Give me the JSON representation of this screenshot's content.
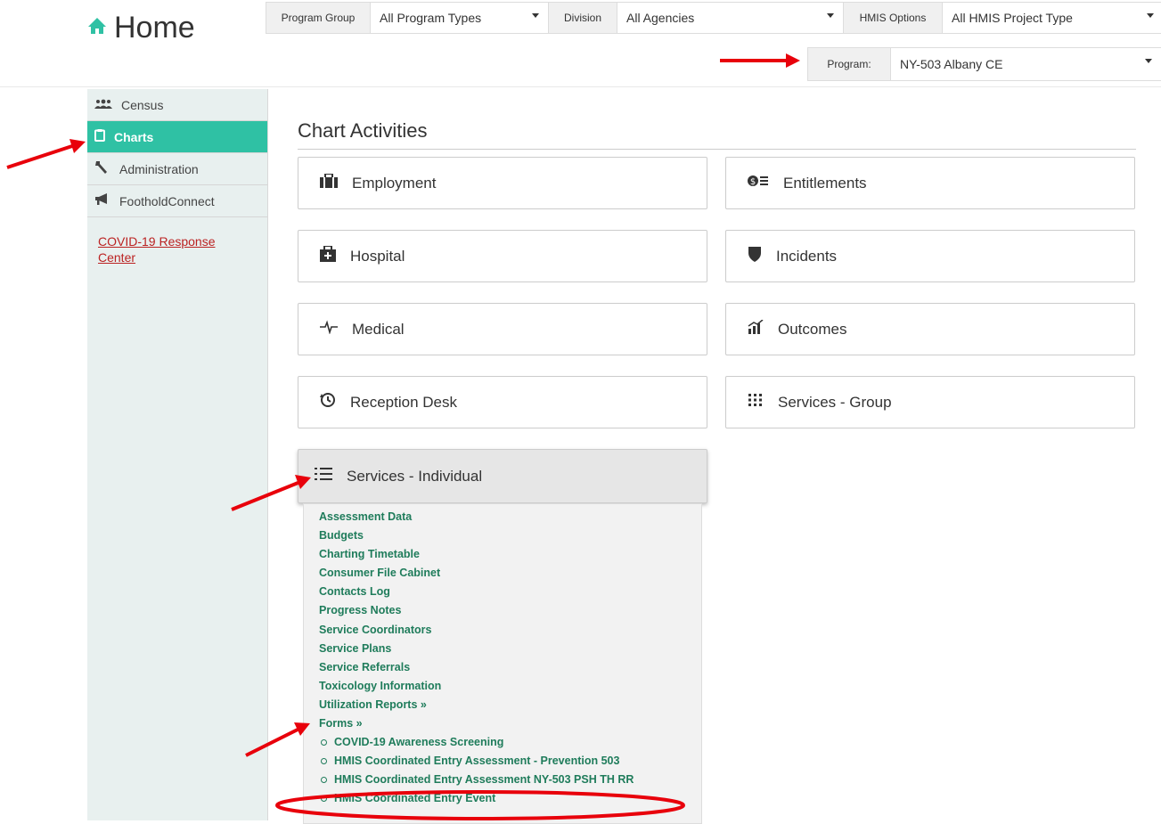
{
  "header": {
    "title": "Home",
    "filters": [
      {
        "label": "Program Group",
        "value": "All Program Types"
      },
      {
        "label": "Division",
        "value": "All Agencies"
      },
      {
        "label": "HMIS Options",
        "value": "All HMIS Project Type"
      }
    ],
    "program": {
      "label": "Program:",
      "value": "NY-503 Albany CE"
    }
  },
  "sidebar": {
    "items": [
      {
        "label": "Census",
        "icon": "users-icon"
      },
      {
        "label": "Charts",
        "icon": "clipboard-icon",
        "active": true
      },
      {
        "label": "Administration",
        "icon": "wrench-icon"
      },
      {
        "label": "FootholdConnect",
        "icon": "megaphone-icon"
      }
    ],
    "covid_link": "COVID-19 Response Center"
  },
  "main": {
    "section_title": "Chart Activities",
    "tiles": [
      {
        "label": "Employment",
        "icon": "briefcase-icon"
      },
      {
        "label": "Entitlements",
        "icon": "money-list-icon"
      },
      {
        "label": "Hospital",
        "icon": "medkit-icon"
      },
      {
        "label": "Incidents",
        "icon": "shield-icon"
      },
      {
        "label": "Medical",
        "icon": "heartbeat-icon"
      },
      {
        "label": "Outcomes",
        "icon": "bar-chart-icon"
      },
      {
        "label": "Reception Desk",
        "icon": "history-icon"
      },
      {
        "label": "Services - Group",
        "icon": "grid-icon"
      },
      {
        "label": "Services - Individual",
        "icon": "list-icon",
        "selected": true
      }
    ],
    "menu": {
      "links": [
        "Assessment Data",
        "Budgets",
        "Charting Timetable",
        "Consumer File Cabinet",
        "Contacts Log",
        "Progress Notes",
        "Service Coordinators",
        "Service Plans",
        "Service Referrals",
        "Toxicology Information",
        "Utilization Reports »",
        "Forms »"
      ],
      "forms": [
        "COVID-19 Awareness Screening",
        "HMIS Coordinated Entry Assessment - Prevention 503",
        "HMIS Coordinated Entry Assessment NY-503 PSH TH RR",
        "HMIS Coordinated Entry Event"
      ]
    }
  },
  "colors": {
    "accent": "#2fc1a4",
    "link": "#1f7c5b",
    "annotation": "#e8000b"
  }
}
